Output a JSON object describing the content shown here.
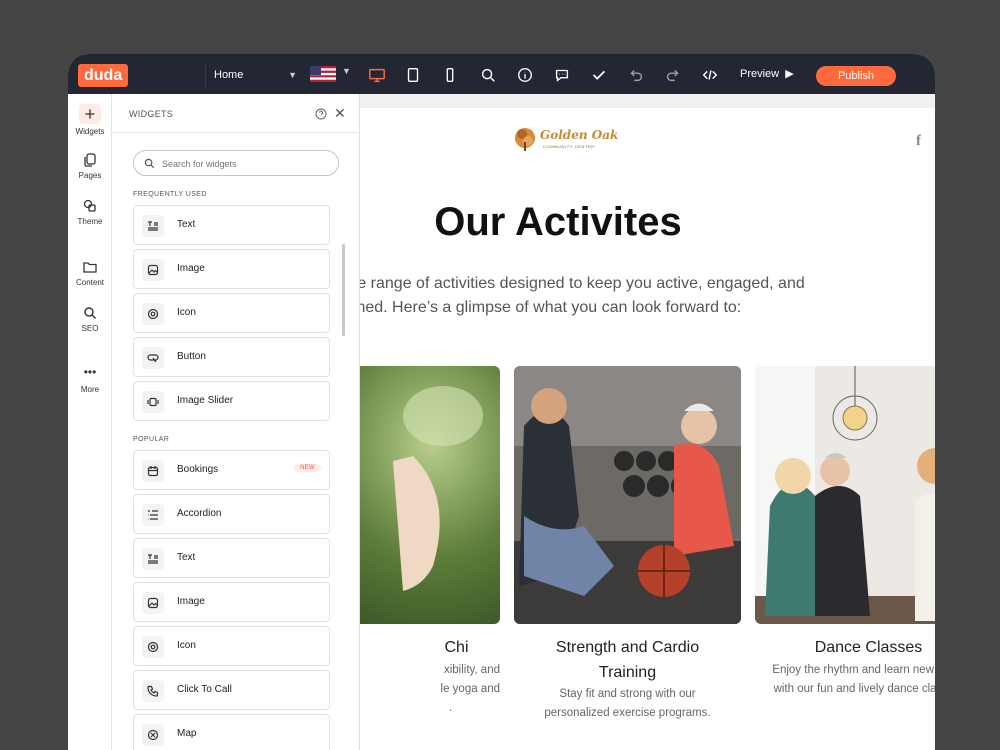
{
  "editor": {
    "logo": "duda",
    "page_select": "Home",
    "preview_label": "Preview",
    "publish_label": "Publish"
  },
  "rail": [
    {
      "label": "Widgets",
      "icon": "plus-icon"
    },
    {
      "label": "Pages",
      "icon": "pages-icon"
    },
    {
      "label": "Theme",
      "icon": "theme-icon"
    },
    {
      "label": "Content",
      "icon": "folder-icon"
    },
    {
      "label": "SEO",
      "icon": "seo-search-icon"
    },
    {
      "label": "More",
      "icon": "more-dots-icon"
    }
  ],
  "panel": {
    "title": "WIDGETS",
    "search_placeholder": "Search for widgets",
    "frequently_used_label": "FREQUENTLY USED",
    "frequently_used": [
      {
        "label": "Text",
        "icon": "text-icon"
      },
      {
        "label": "Image",
        "icon": "image-icon"
      },
      {
        "label": "Icon",
        "icon": "icon-icon"
      },
      {
        "label": "Button",
        "icon": "button-icon"
      },
      {
        "label": "Image Slider",
        "icon": "image-slider-icon"
      }
    ],
    "popular_label": "POPULAR",
    "popular": [
      {
        "label": "Bookings",
        "icon": "calendar-icon",
        "badge": "NEW"
      },
      {
        "label": "Accordion",
        "icon": "accordion-icon"
      },
      {
        "label": "Text",
        "icon": "text-icon"
      },
      {
        "label": "Image",
        "icon": "image-icon"
      },
      {
        "label": "Icon",
        "icon": "icon-icon"
      },
      {
        "label": "Click To Call",
        "icon": "phone-icon"
      },
      {
        "label": "Map",
        "icon": "map-icon"
      }
    ]
  },
  "site": {
    "logo_text": "Golden Oak",
    "logo_subtext": "COMMUNITY CENTER",
    "heading": "Our Activites",
    "intro_line1": "rse range of activities designed to keep you active, engaged, and",
    "intro_line2": "ained. Here’s a glimpse of what you can look forward to:",
    "cards": [
      {
        "title": "Chi",
        "desc_line1": "xibility, and",
        "desc_line2": "le yoga and",
        "desc_line3": "."
      },
      {
        "title_line1": "Strength and Cardio",
        "title_line2": "Training",
        "desc_line1": "Stay fit and strong with our",
        "desc_line2": "personalized exercise programs."
      },
      {
        "title": "Dance Classes",
        "desc_line1": "Enjoy the rhythm and learn new steps",
        "desc_line2": "with our fun and lively dance classes."
      }
    ]
  },
  "colors": {
    "accent": "#ff6a3d",
    "topbar": "#222733",
    "backdrop": "#444444"
  }
}
